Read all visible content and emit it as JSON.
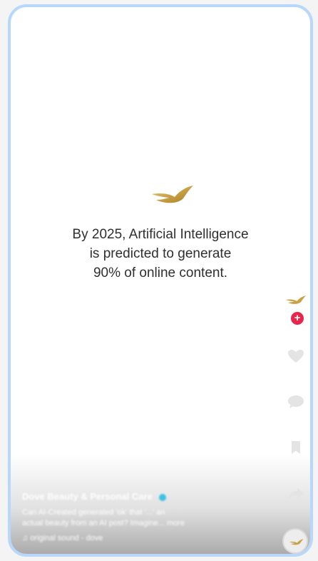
{
  "colors": {
    "frame_border": "#b7d7fb",
    "gold": "#c9a247",
    "follow_badge": "#e8254b",
    "verified": "#3bc2e6",
    "text": "#2f2f2f"
  },
  "video": {
    "headline_lines": [
      "By 2025, Artificial Intelligence",
      "is predicted to generate",
      "90% of online content."
    ],
    "brand_icon": "dove-logo-icon"
  },
  "action_rail": {
    "avatar_icon": "dove-logo-icon",
    "follow_icon": "plus-icon",
    "follow_label": "+",
    "items": [
      {
        "icon": "heart-icon",
        "count": ""
      },
      {
        "icon": "comment-icon",
        "count": ""
      },
      {
        "icon": "bookmark-icon",
        "count": ""
      },
      {
        "icon": "share-icon",
        "count": ""
      }
    ],
    "sound_icon": "dove-logo-icon"
  },
  "caption": {
    "author": "Dove Beauty & Personal Care",
    "description_line1": "Can AI-Created generated 'ok' that '...' an",
    "description_line2": "actual beauty from an AI post? Imagine... more",
    "sound": "♫ original sound - dove"
  }
}
